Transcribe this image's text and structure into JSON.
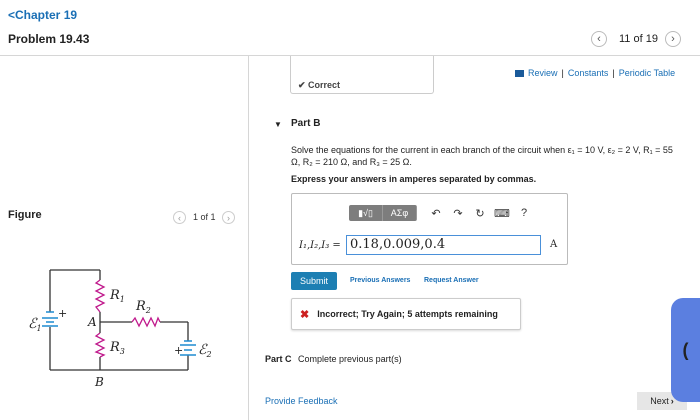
{
  "header": {
    "chapter": "Chapter 19",
    "problem": "Problem 19.43",
    "counter": "11 of 19"
  },
  "figure": {
    "label": "Figure",
    "counter": "1 of 1",
    "labels": {
      "emf1": "ℰ",
      "emf1_sub": "1",
      "emf2": "ℰ",
      "emf2_sub": "2",
      "r1": "R",
      "r1_sub": "1",
      "r2": "R",
      "r2_sub": "2",
      "r3": "R",
      "r3_sub": "3",
      "node_a": "A",
      "node_b": "B",
      "plus1": "+",
      "plus2": "+"
    }
  },
  "links": {
    "review": "Review",
    "constants": "Constants",
    "periodic_table": "Periodic Table",
    "separator": "|"
  },
  "previous_part": {
    "status": "Correct"
  },
  "part_b": {
    "title": "Part B",
    "question": "Solve the equations for the current in each branch of the circuit when ε₁ = 10 V, ε₂ = 2 V, R₁ = 55 Ω, R₂ = 210 Ω, and R₃ = 25 Ω.",
    "instruction": "Express your answers in amperes separated by commas.",
    "toolbar": {
      "templates": "▮√▯",
      "symbols": "ΑΣφ",
      "undo": "↶",
      "redo": "↷",
      "reset": "↻",
      "keyboard": "⌨",
      "help": "?"
    },
    "input_label": "I₁,I₂,I₃ =",
    "input_value": "0.18,0.009,0.4",
    "unit": "A",
    "submit": "Submit",
    "previous_answers": "Previous Answers",
    "request_answer": "Request Answer",
    "feedback": "Incorrect; Try Again; 5 attempts remaining"
  },
  "part_c": {
    "title": "Part C",
    "status": "Complete previous part(s)"
  },
  "footer": {
    "provide_feedback": "Provide Feedback",
    "next": "Next"
  },
  "colors": {
    "link": "#1a6fb5",
    "submit": "#1d7fb3",
    "error": "#cc1f1f",
    "side_tab": "#5b7fe0"
  }
}
